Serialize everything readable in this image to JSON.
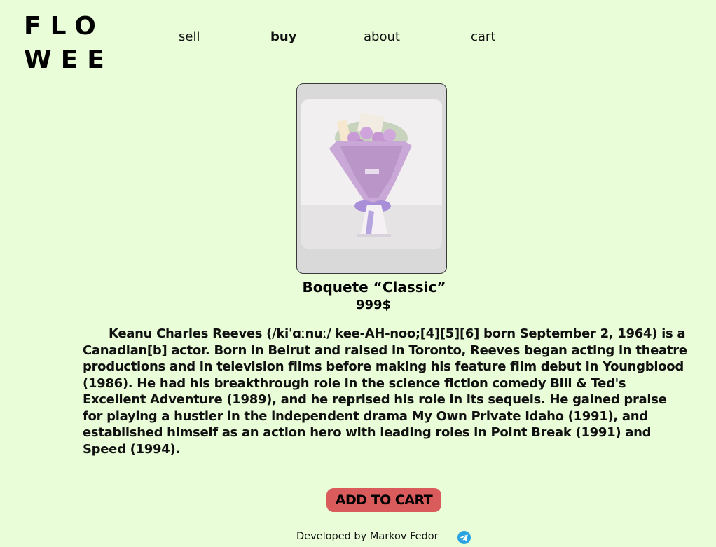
{
  "logo": {
    "line1": "FLO",
    "line2": "WEE"
  },
  "nav": {
    "items": [
      {
        "label": "sell"
      },
      {
        "label": "buy"
      },
      {
        "label": "about"
      },
      {
        "label": "cart"
      }
    ],
    "active": "buy"
  },
  "product": {
    "image_icon": "bouquet-image",
    "title": "Boquete “Classic”",
    "price": "999$",
    "description": "Keanu Charles Reeves (/kiˈɑːnuː/ kee-AH-noo;[4][5][6] born September 2, 1964) is a Canadian[b] actor. Born in Beirut and raised in Toronto, Reeves began acting in theatre productions and in television films before making his feature film debut in Youngblood (1986). He had his breakthrough role in the science fiction comedy Bill & Ted's Excellent Adventure (1989), and he reprised his role in its sequels. He gained praise for playing a hustler in the independent drama My Own Private Idaho (1991), and established himself as an action hero with leading roles in Point Break (1991) and Speed (1994)."
  },
  "actions": {
    "add_to_cart_label": "ADD TO CART"
  },
  "footer": {
    "credit": "Developed by Markov Fedor",
    "social_icon": "telegram-icon"
  },
  "colors": {
    "background": "#e8fdd8",
    "button": "#d95b5b",
    "frame": "#d9d9d9",
    "telegram": "#2aa3e0"
  }
}
